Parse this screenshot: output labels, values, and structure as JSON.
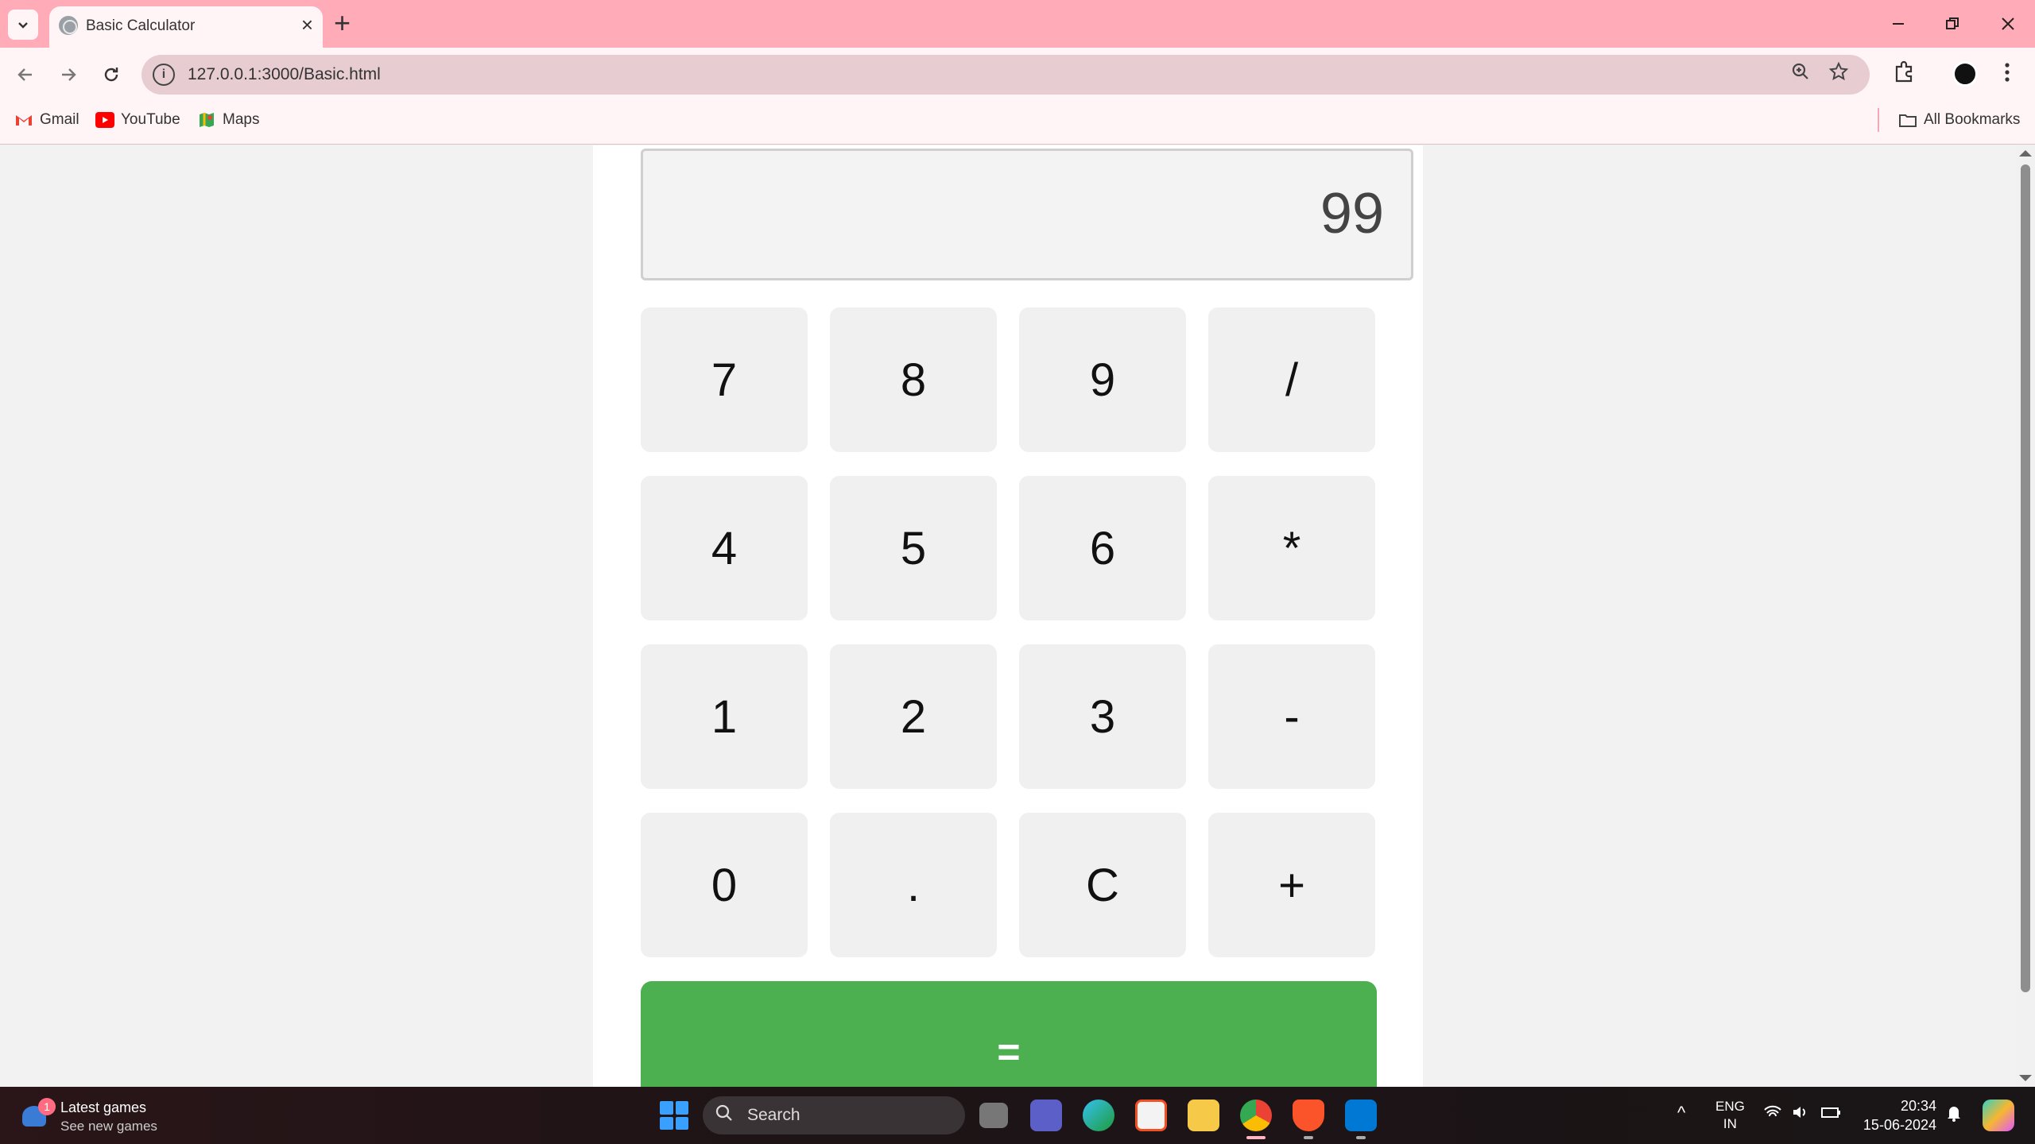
{
  "browser": {
    "tab_title": "Basic Calculator",
    "url": "127.0.0.1:3000/Basic.html",
    "bookmarks": [
      {
        "label": "Gmail",
        "icon": "gmail-icon"
      },
      {
        "label": "YouTube",
        "icon": "youtube-icon"
      },
      {
        "label": "Maps",
        "icon": "maps-icon"
      }
    ],
    "all_bookmarks_label": "All Bookmarks"
  },
  "calculator": {
    "display_value": "99",
    "keys": [
      [
        "7",
        "8",
        "9",
        "/"
      ],
      [
        "4",
        "5",
        "6",
        "*"
      ],
      [
        "1",
        "2",
        "3",
        "-"
      ],
      [
        "0",
        ".",
        "C",
        "+"
      ]
    ],
    "equals_label": "=",
    "equals_color": "#4caf50"
  },
  "taskbar": {
    "news_badge": "1",
    "news_title": "Latest games",
    "news_subtitle": "See new games",
    "search_placeholder": "Search",
    "lang_top": "ENG",
    "lang_bottom": "IN",
    "time": "20:34",
    "date": "15-06-2024"
  },
  "colors": {
    "tabbar": "#ffacb8",
    "toolbar": "#fff4f6",
    "accent_green": "#4caf50"
  }
}
